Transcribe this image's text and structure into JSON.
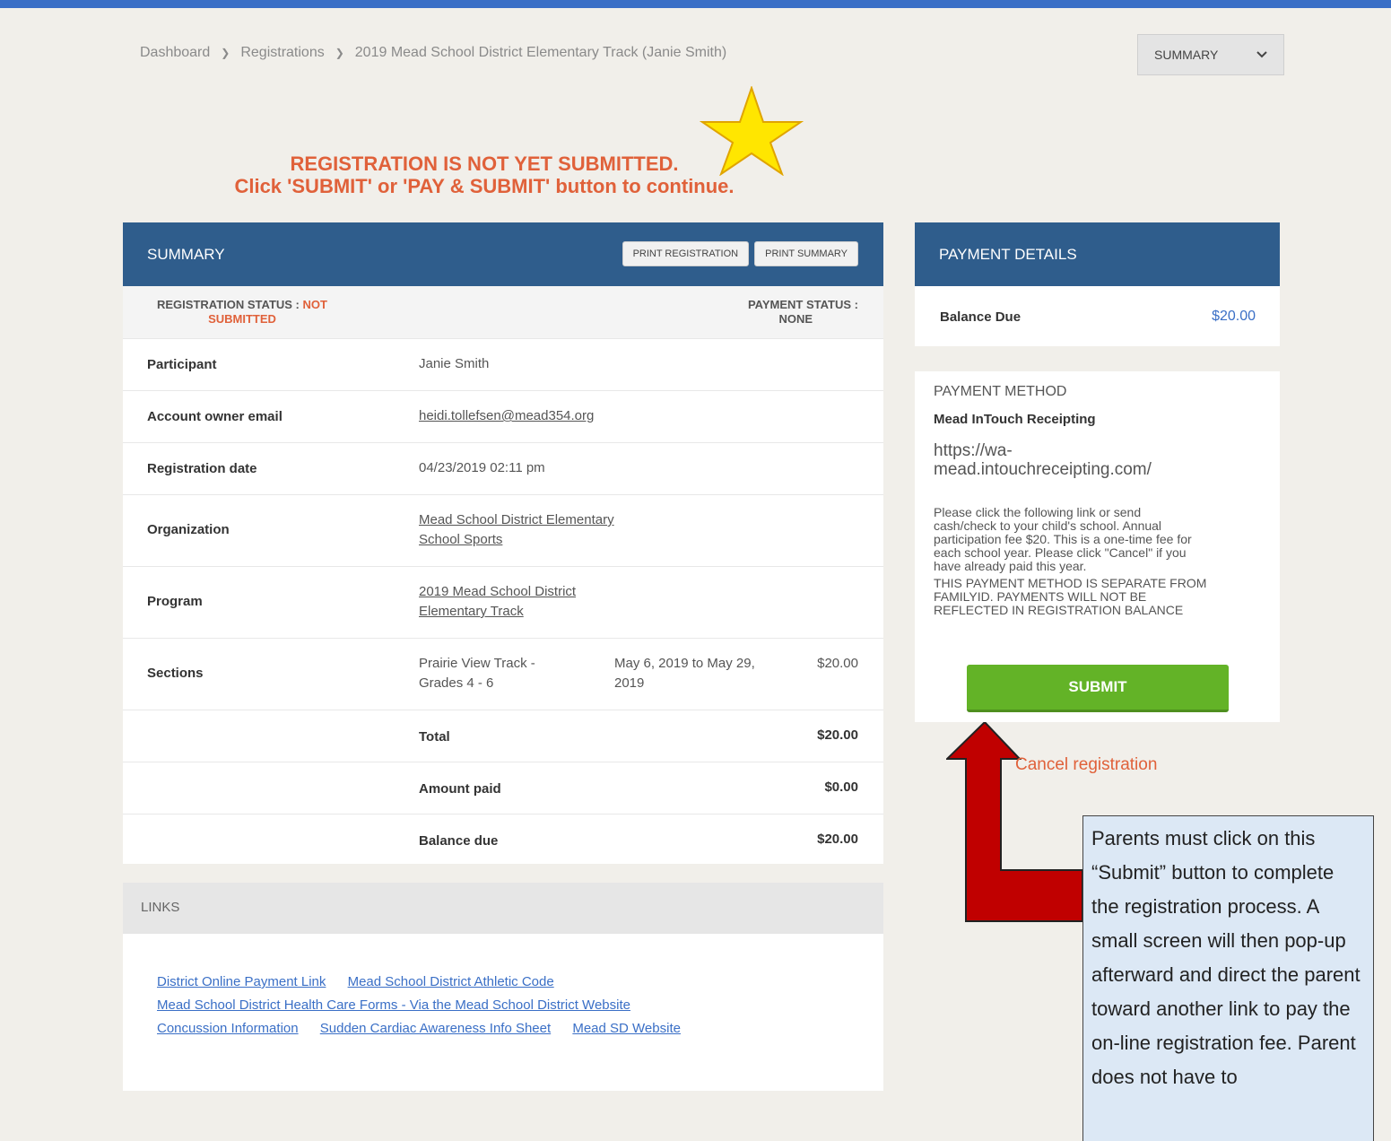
{
  "breadcrumb": {
    "items": [
      "Dashboard",
      "Registrations",
      "2019 Mead School District Elementary Track (Janie Smith)"
    ]
  },
  "view_select": {
    "label": "SUMMARY"
  },
  "notice": {
    "line1": "REGISTRATION IS NOT YET SUBMITTED.",
    "line2": "Click 'SUBMIT' or 'PAY & SUBMIT' button to continue."
  },
  "summary": {
    "title": "SUMMARY",
    "print_registration": "PRINT REGISTRATION",
    "print_summary": "PRINT SUMMARY",
    "registration_status_label": "REGISTRATION STATUS :",
    "registration_status_value_1": "NOT",
    "registration_status_value_2": "SUBMITTED",
    "payment_status_label": "PAYMENT STATUS :",
    "payment_status_value": "NONE",
    "participant_label": "Participant",
    "participant_value": "Janie Smith",
    "email_label": "Account owner email",
    "email_value": "heidi.tollefsen@mead354.org",
    "date_label": "Registration date",
    "date_value": "04/23/2019 02:11 pm",
    "org_label": "Organization",
    "org_value_1": "Mead School District Elementary",
    "org_value_2": "School Sports",
    "program_label": "Program",
    "program_value_1": "2019 Mead School District",
    "program_value_2": "Elementary Track",
    "sections_label": "Sections",
    "section_name_1": "Prairie View Track -",
    "section_name_2": "Grades 4 - 6",
    "section_dates_1": "May 6, 2019 to May 29,",
    "section_dates_2": "2019",
    "section_price": "$20.00",
    "total_label": "Total",
    "total_value": "$20.00",
    "paid_label": "Amount paid",
    "paid_value": "$0.00",
    "balance_label": "Balance due",
    "balance_value": "$20.00"
  },
  "links": {
    "title": "LINKS",
    "items": [
      "District Online Payment Link",
      "Mead School District Athletic Code",
      "Mead School District Health Care Forms - Via the Mead School District Website",
      "Concussion Information",
      "Sudden Cardiac Awareness Info Sheet",
      "Mead SD Website"
    ]
  },
  "payment_details": {
    "title": "PAYMENT DETAILS",
    "balance_label": "Balance Due",
    "balance_value": "$20.00"
  },
  "payment_method": {
    "title": "PAYMENT METHOD",
    "name": "Mead InTouch Receipting",
    "url_1": "https://wa-",
    "url_2": "mead.intouchreceipting.com/",
    "desc_1": "Please click the following link or send",
    "desc_2": "cash/check to your child's school. Annual",
    "desc_3": "participation fee $20. This is a one-time fee for",
    "desc_4": "each school year. Please click \"Cancel\" if you",
    "desc_5": "have already paid this year.",
    "desc_6": "THIS PAYMENT METHOD IS SEPARATE FROM",
    "desc_7": "FAMILYID. PAYMENTS WILL NOT BE",
    "desc_8": "REFLECTED IN REGISTRATION BALANCE",
    "submit": "SUBMIT"
  },
  "cancel": {
    "label": "Cancel registration"
  },
  "callout": {
    "text": "Parents must click on this “Submit” button to complete the registration process. A small screen will then pop-up afterward and direct the parent toward another link to pay the on-line registration fee. Parent does not have to"
  },
  "colors": {
    "header": "#2f5d8c",
    "accent": "#e0613a",
    "submit": "#63b327",
    "arrow": "#c00000",
    "star": "#ffe600"
  }
}
